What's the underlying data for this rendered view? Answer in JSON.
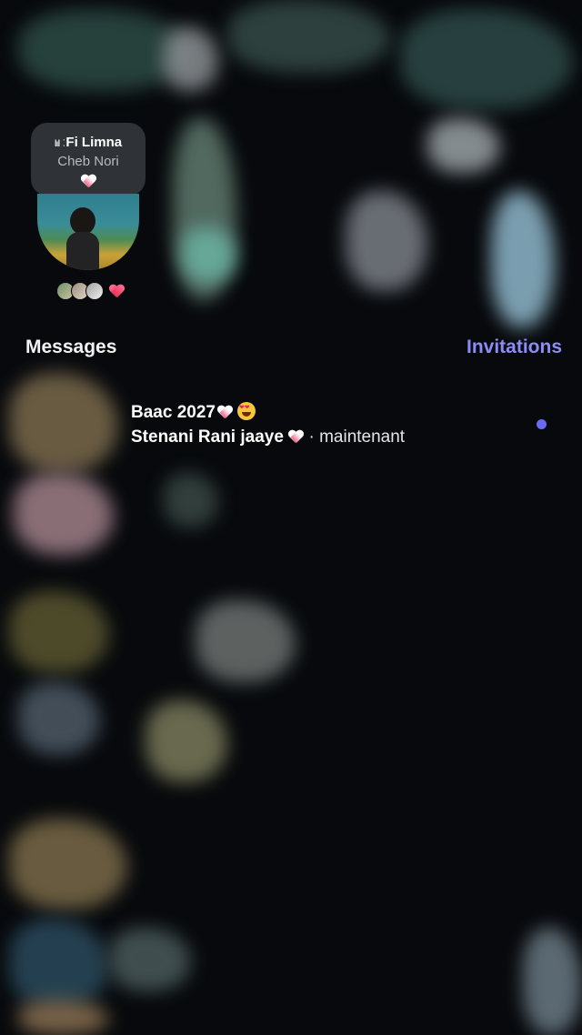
{
  "colors": {
    "background": "#07090c",
    "accent": "#8c8cf5",
    "unread_dot": "#6a6af0",
    "note_bubble": "#2f3236"
  },
  "notes": {
    "song_title": "Fi Limna",
    "song_title_prefix": ":",
    "artist": "Cheb Nori",
    "bars_icon": "music-bars-icon",
    "heart_icon": "heart-icon"
  },
  "header": {
    "messages_label": "Messages",
    "invitations_label": "Invitations"
  },
  "threads": [
    {
      "name": "Baac 2027",
      "name_emojis": [
        "heart-icon",
        "heart-eyes-emoji"
      ],
      "preview": "Stenani Rani jaaye",
      "preview_emoji": "heart-icon",
      "separator": "·",
      "time": "maintenant",
      "unread": true
    }
  ]
}
